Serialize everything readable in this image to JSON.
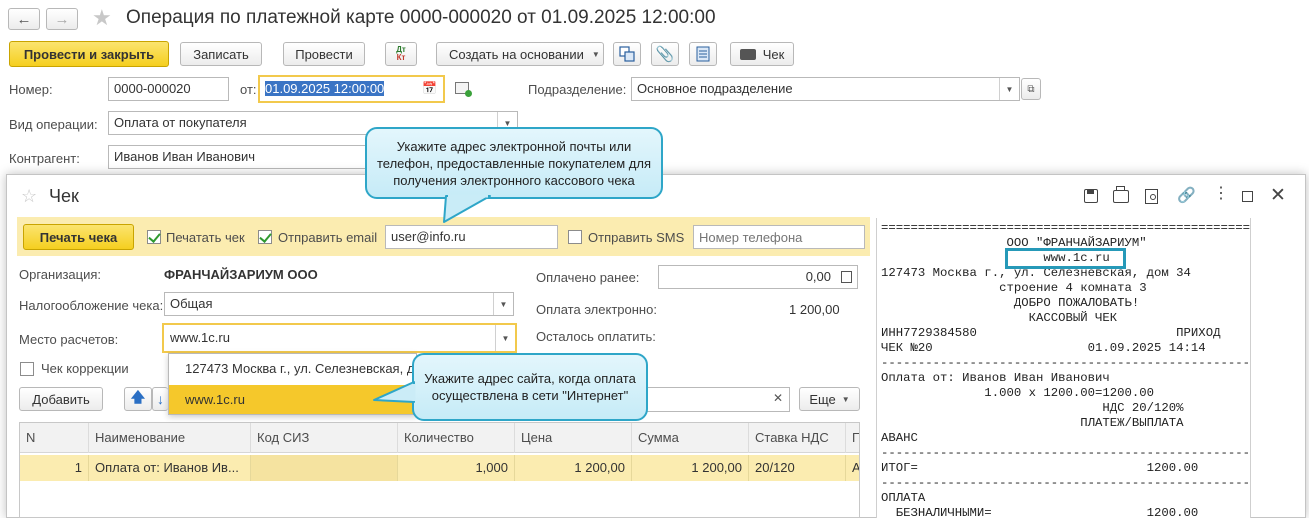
{
  "window": {
    "title": "Операция по платежной карте 0000-000020 от 01.09.2025 12:00:00",
    "back_icon": "arrow-left",
    "forward_icon": "arrow-right",
    "star_icon": "star"
  },
  "toolbar": {
    "post_close": "Провести и закрыть",
    "save": "Записать",
    "post": "Провести",
    "dtkt_top": "Дт",
    "dtkt_bottom": "Кт",
    "create_based": "Создать на основании",
    "receipt": "Чек"
  },
  "header": {
    "number_label": "Номер:",
    "number_value": "0000-000020",
    "date_label": "от:",
    "date_value": "01.09.2025 12:00:00",
    "division_label": "Подразделение:",
    "division_value": "Основное подразделение",
    "operation_label": "Вид операции:",
    "operation_value": "Оплата от покупателя",
    "counterparty_label": "Контрагент:",
    "counterparty_value": "Иванов Иван Иванович"
  },
  "callout1": {
    "text": "Укажите адрес электронной почты или телефон, предоставленные покупателем для получения электронного кассового чека"
  },
  "callout2": {
    "text": "Укажите адрес сайта, когда оплата осуществлена в сети \"Интернет\""
  },
  "check_dialog": {
    "title": "Чек",
    "print_button": "Печать чека",
    "print_check_label": "Печатать чек",
    "print_check_on": true,
    "send_email_label": "Отправить email",
    "send_email_on": true,
    "email_value": "user@info.ru",
    "send_sms_label": "Отправить SMS",
    "send_sms_on": false,
    "phone_placeholder": "Номер телефона",
    "org_label": "Организация:",
    "org_value": "ФРАНЧАЙЗАРИУМ ООО",
    "tax_label": "Налогообложение чека:",
    "tax_value": "Общая",
    "place_label": "Место расчетов:",
    "place_value": "www.1c.ru",
    "correction_label": "Чек коррекции",
    "paid_before_label": "Оплачено ранее:",
    "paid_before_value": "0,00",
    "paid_electronic_label": "Оплата электронно:",
    "paid_electronic_value": "1 200,00",
    "remaining_label": "Осталось оплатить:",
    "add_button": "Добавить",
    "more_button": "Еще",
    "dropdown_options": [
      "127473 Москва г., ул. Селезневская, д",
      "www.1c.ru"
    ],
    "table": {
      "columns": [
        "N",
        "Наименование",
        "Код СИЗ",
        "Количество",
        "Цена",
        "Сумма",
        "Ставка НДС",
        "П"
      ],
      "rows": [
        [
          "1",
          "Оплата от: Иванов Ив...",
          "",
          "1,000",
          "1 200,00",
          "1 200,00",
          "20/120",
          "А"
        ]
      ]
    }
  },
  "receipt": {
    "lines": [
      "=======================================================",
      "                 ООО \"ФРАНЧАЙЗАРИУМ\"",
      "                      www.1c.ru",
      "127473 Москва г., ул. Селезневская, дом 34",
      "                строение 4 комната 3",
      "                  ДОБРО ПОЖАЛОВАТЬ!",
      "                    КАССОВЫЙ ЧЕК",
      "ИНН7729384580                           ПРИХОД",
      "ЧЕК №20                     01.09.2025 14:14",
      "-------------------------------------------------------",
      "Оплата от: Иванов Иван Иванович",
      "              1.000 x 1200.00=1200.00",
      "                              НДС 20/120%",
      "                           ПЛАТЕЖ/ВЫПЛАТА",
      "АВАНС",
      "-------------------------------------------------------",
      "ИТОГ=                               1200.00",
      "-------------------------------------------------------",
      "ОПЛАТА",
      "  БЕЗНАЛИЧНЫМИ=                     1200.00"
    ]
  }
}
